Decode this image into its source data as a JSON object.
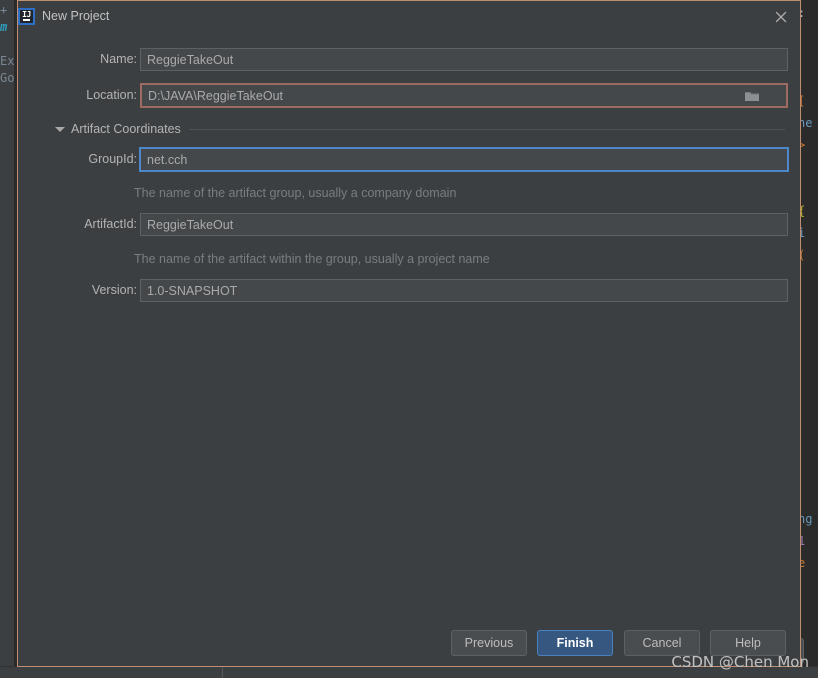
{
  "dialog": {
    "title": "New Project",
    "app_icon": "intellij-idea-icon",
    "close_icon": "close-icon"
  },
  "form": {
    "name": {
      "label": "Name:",
      "value": "ReggieTakeOut",
      "placeholder": "Name"
    },
    "location": {
      "label": "Location:",
      "value": "D:\\JAVA\\ReggieTakeOut",
      "placeholder": "Location",
      "state": "error",
      "browse_icon": "folder-icon"
    },
    "artifact_section": {
      "label": "Artifact Coordinates",
      "expanded": true,
      "toggle_icon": "chevron-down-icon"
    },
    "group_id": {
      "label": "GroupId:",
      "value": "net.cch",
      "placeholder": "GroupId",
      "state": "focused",
      "hint": "The name of the artifact group, usually a company domain"
    },
    "artifact_id": {
      "label": "ArtifactId:",
      "value": "ReggieTakeOut",
      "placeholder": "ArtifactId",
      "hint": "The name of the artifact within the group, usually a project name"
    },
    "version": {
      "label": "Version:",
      "value": "1.0-SNAPSHOT",
      "placeholder": "Version"
    }
  },
  "footer": {
    "previous_label": "Previous",
    "finish_label": "Finish",
    "cancel_label": "Cancel",
    "help_label": "Help"
  },
  "watermark": {
    "text": "CSDN @Chen Mon"
  },
  "colors": {
    "dialog_bg": "#3c3f41",
    "dialog_border": "#c08f72",
    "field_bg": "#45484a",
    "field_border": "#5e6163",
    "focus_border": "#4a88c7",
    "error_border": "#9e6b62",
    "primary_button_bg": "#365880",
    "text": "#b4b4b4",
    "hint_text": "#7a7d80"
  },
  "background": {
    "code_left": [
      "m",
      "Ex",
      "Go"
    ],
    "code_right": [
      "[",
      "ne",
      ">",
      "{",
      "i",
      "(",
      "ng",
      "1",
      "e"
    ]
  }
}
